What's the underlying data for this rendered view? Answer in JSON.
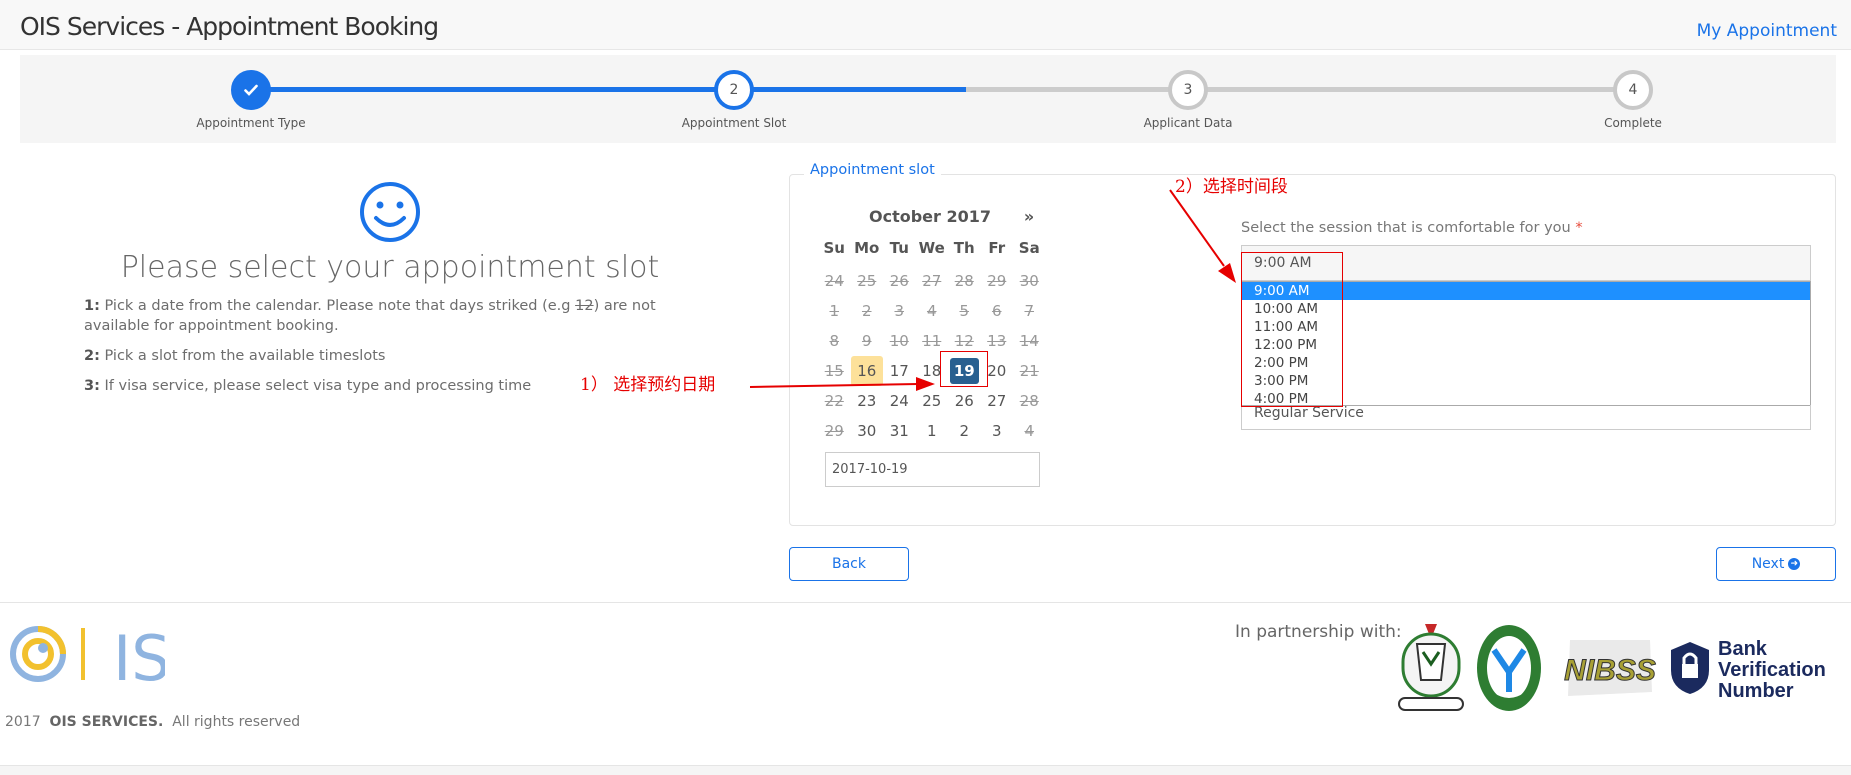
{
  "header": {
    "title": "OIS Services - Appointment Booking",
    "my_appointment": "My Appointment"
  },
  "steps": [
    {
      "number": "",
      "label": "Appointment Type",
      "state": "complete",
      "icon": "check-icon"
    },
    {
      "number": "2",
      "label": "Appointment Slot",
      "state": "active"
    },
    {
      "number": "3",
      "label": "Applicant Data",
      "state": "pending"
    },
    {
      "number": "4",
      "label": "Complete",
      "state": "pending"
    }
  ],
  "intro": {
    "icon": "smiley-icon",
    "title": "Please select your appointment slot",
    "instructions": [
      {
        "num": "1:",
        "text_before": "Pick a date from the calendar. Please note that days striked (e.g ",
        "struck": "12",
        "text_after": ") are not available for appointment booking."
      },
      {
        "num": "2:",
        "text": "Pick a slot from the available timeslots"
      },
      {
        "num": "3:",
        "text": "If visa service, please select visa type and processing time"
      }
    ]
  },
  "slot_panel": {
    "legend": "Appointment slot",
    "calendar": {
      "month": "October 2017",
      "next_symbol": "»",
      "weekdays": [
        "Su",
        "Mo",
        "Tu",
        "We",
        "Th",
        "Fr",
        "Sa"
      ],
      "weeks": [
        [
          {
            "d": "24",
            "s": "disabled"
          },
          {
            "d": "25",
            "s": "disabled"
          },
          {
            "d": "26",
            "s": "disabled"
          },
          {
            "d": "27",
            "s": "disabled"
          },
          {
            "d": "28",
            "s": "disabled"
          },
          {
            "d": "29",
            "s": "disabled"
          },
          {
            "d": "30",
            "s": "disabled"
          }
        ],
        [
          {
            "d": "1",
            "s": "disabled"
          },
          {
            "d": "2",
            "s": "disabled"
          },
          {
            "d": "3",
            "s": "disabled"
          },
          {
            "d": "4",
            "s": "disabled"
          },
          {
            "d": "5",
            "s": "disabled"
          },
          {
            "d": "6",
            "s": "disabled"
          },
          {
            "d": "7",
            "s": "disabled"
          }
        ],
        [
          {
            "d": "8",
            "s": "disabled"
          },
          {
            "d": "9",
            "s": "disabled"
          },
          {
            "d": "10",
            "s": "disabled"
          },
          {
            "d": "11",
            "s": "disabled"
          },
          {
            "d": "12",
            "s": "disabled"
          },
          {
            "d": "13",
            "s": "disabled"
          },
          {
            "d": "14",
            "s": "disabled"
          }
        ],
        [
          {
            "d": "15",
            "s": "disabled"
          },
          {
            "d": "16",
            "s": "today"
          },
          {
            "d": "17",
            "s": ""
          },
          {
            "d": "18",
            "s": ""
          },
          {
            "d": "19",
            "s": "selected"
          },
          {
            "d": "20",
            "s": ""
          },
          {
            "d": "21",
            "s": "disabled"
          }
        ],
        [
          {
            "d": "22",
            "s": "disabled"
          },
          {
            "d": "23",
            "s": ""
          },
          {
            "d": "24",
            "s": ""
          },
          {
            "d": "25",
            "s": ""
          },
          {
            "d": "26",
            "s": ""
          },
          {
            "d": "27",
            "s": ""
          },
          {
            "d": "28",
            "s": "disabled"
          }
        ],
        [
          {
            "d": "29",
            "s": "disabled"
          },
          {
            "d": "30",
            "s": ""
          },
          {
            "d": "31",
            "s": ""
          },
          {
            "d": "1",
            "s": ""
          },
          {
            "d": "2",
            "s": ""
          },
          {
            "d": "3",
            "s": ""
          },
          {
            "d": "4",
            "s": "disabled"
          }
        ]
      ],
      "selected_date_value": "2017-10-19"
    },
    "session": {
      "label": "Select the session that is comfortable for you",
      "required_mark": "*",
      "selected": "9:00 AM",
      "options": [
        "9:00 AM",
        "10:00 AM",
        "11:00 AM",
        "12:00 PM",
        "2:00 PM",
        "3:00 PM",
        "4:00 PM"
      ]
    },
    "service_type": "Regular Service"
  },
  "annotations": {
    "step1": "1） 选择预约日期",
    "step2": "2）选择时间段"
  },
  "buttons": {
    "back": "Back",
    "next": "Next"
  },
  "footer": {
    "logo_text": "IS",
    "copyright_year": "2017",
    "company": "OIS SERVICES.",
    "rights": "All rights reserved",
    "partner_label": "In partnership with:",
    "partners": [
      "nigeria-immigration-service-logo",
      "central-bank-of-nigeria-logo",
      "nibss-logo",
      "bank-verification-number-logo"
    ],
    "bvn_lines": [
      "Bank",
      "Verification",
      "Number"
    ],
    "nibss_text": "NIBSS"
  },
  "colors": {
    "accent": "#1a73e8",
    "selected_day": "#286090",
    "today": "#fde19a",
    "annotation": "#e60000",
    "list_selected": "#1e90ff"
  }
}
